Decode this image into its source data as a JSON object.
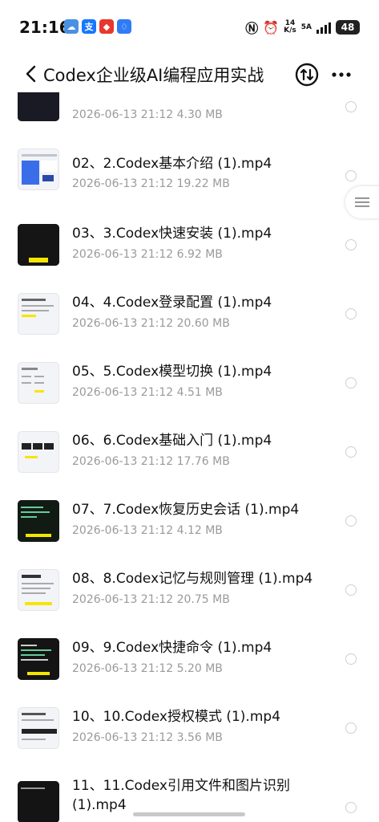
{
  "status_bar": {
    "time": "21:16",
    "net_speed_value": "14",
    "net_speed_unit": "K/s",
    "network_type": "5A",
    "battery": "48",
    "app_icons": [
      "weather-icon",
      "alipay-icon",
      "app-icon",
      "lightbulb-icon"
    ]
  },
  "header": {
    "title": "Codex企业级AI编程应用实战",
    "back_icon": "chevron-left-icon",
    "sort_icon": "sort-arrows-icon",
    "more_icon": "more-dots-icon"
  },
  "files": [
    {
      "name": "",
      "meta": "2026-06-13 21:12  4.30 MB",
      "thumb": "dark"
    },
    {
      "name": "02、2.Codex基本介绍 (1).mp4",
      "meta": "2026-06-13 21:12  19.22 MB",
      "thumb": "light"
    },
    {
      "name": "03、3.Codex快速安装 (1).mp4",
      "meta": "2026-06-13 21:12  6.92 MB",
      "thumb": "dark"
    },
    {
      "name": "04、4.Codex登录配置 (1).mp4",
      "meta": "2026-06-13 21:12  20.60 MB",
      "thumb": "light"
    },
    {
      "name": "05、5.Codex模型切换 (1).mp4",
      "meta": "2026-06-13 21:12  4.51 MB",
      "thumb": "light"
    },
    {
      "name": "06、6.Codex基础入门 (1).mp4",
      "meta": "2026-06-13 21:12  17.76 MB",
      "thumb": "light"
    },
    {
      "name": "07、7.Codex恢复历史会话 (1).mp4",
      "meta": "2026-06-13 21:12  4.12 MB",
      "thumb": "dark"
    },
    {
      "name": "08、8.Codex记忆与规则管理 (1).mp4",
      "meta": "2026-06-13 21:12  20.75 MB",
      "thumb": "light"
    },
    {
      "name": "09、9.Codex快捷命令 (1).mp4",
      "meta": "2026-06-13 21:12  5.20 MB",
      "thumb": "dark"
    },
    {
      "name": "10、10.Codex授权模式 (1).mp4",
      "meta": "2026-06-13 21:12  3.56 MB",
      "thumb": "light"
    },
    {
      "name": "11、11.Codex引用文件和图片识别 (1).mp4",
      "meta": "",
      "thumb": "dark"
    }
  ],
  "colors": {
    "text_primary": "#111111",
    "text_secondary": "#9a9a9a",
    "highlight_yellow": "#f5e600"
  }
}
